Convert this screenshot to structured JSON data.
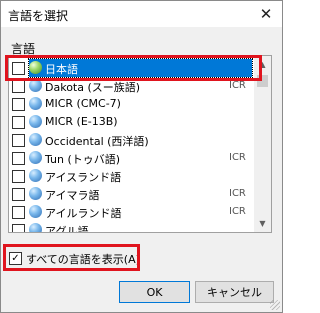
{
  "dialog": {
    "title": "言語を選択",
    "close_glyph": "✕",
    "group_label": "言語"
  },
  "languages": [
    {
      "name": "日本語",
      "code": "",
      "checked": false,
      "selected": true
    },
    {
      "name": "Dakota (スー族語)",
      "code": "ICR",
      "checked": false,
      "selected": false
    },
    {
      "name": "MICR (CMC-7)",
      "code": "",
      "checked": false,
      "selected": false
    },
    {
      "name": "MICR (E-13B)",
      "code": "",
      "checked": false,
      "selected": false
    },
    {
      "name": "Occidental (西洋語)",
      "code": "",
      "checked": false,
      "selected": false
    },
    {
      "name": "Tun (トゥバ語)",
      "code": "ICR",
      "checked": false,
      "selected": false
    },
    {
      "name": "アイスランド語",
      "code": "",
      "checked": false,
      "selected": false
    },
    {
      "name": "アイマラ語",
      "code": "ICR",
      "checked": false,
      "selected": false
    },
    {
      "name": "アイルランド語",
      "code": "ICR",
      "checked": false,
      "selected": false
    },
    {
      "name": "アグル語",
      "code": "",
      "checked": false,
      "selected": false
    }
  ],
  "show_all": {
    "label": "すべての言語を表示(A)",
    "checked": true,
    "check_glyph": "✓"
  },
  "buttons": {
    "ok": "OK",
    "cancel": "キャンセル"
  },
  "scrollbar": {
    "up_glyph": "▲",
    "down_glyph": "▼"
  },
  "colors": {
    "selection": "#0078d7",
    "annotation": "#e0141e"
  }
}
